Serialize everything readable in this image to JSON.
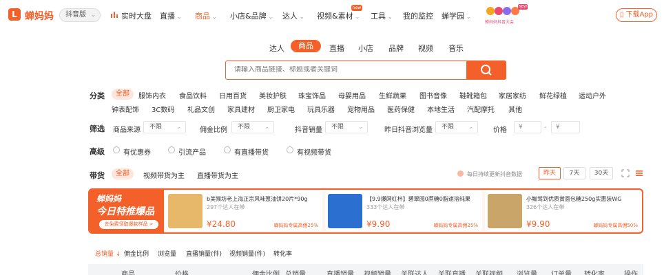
{
  "app": {
    "logo_mark": "L",
    "logo_text": "蝉妈妈",
    "version": "抖音版"
  },
  "nav": {
    "items": [
      {
        "label": "实时大盘"
      },
      {
        "label": "直播"
      },
      {
        "label": "商品"
      },
      {
        "label": "小店&品牌"
      },
      {
        "label": "达人"
      },
      {
        "label": "视频&素材"
      },
      {
        "label": "工具"
      },
      {
        "label": "我的监控"
      },
      {
        "label": "蝉学园"
      }
    ],
    "new_badge": "new",
    "promo_badge": "NEW",
    "promo_sub": "蝉妈妈抖音大会",
    "download": "下载App"
  },
  "search": {
    "tabs": [
      "达人",
      "商品",
      "直播",
      "小店",
      "品牌",
      "视频",
      "音乐"
    ],
    "active_tab": "商品",
    "placeholder": "请输入商品链接、标题或者关键词"
  },
  "filters": {
    "category_label": "分类",
    "categories_row1": [
      "全部",
      "服饰内衣",
      "食品饮料",
      "日用百货",
      "美妆护肤",
      "珠宝饰品",
      "母婴用品",
      "生鲜蔬果",
      "图书音像",
      "鞋靴箱包",
      "家居家纺",
      "鲜花绿植",
      "运动户外"
    ],
    "categories_row2": [
      "钟表配饰",
      "3C数码",
      "礼品文创",
      "家具建材",
      "厨卫家电",
      "玩具乐器",
      "宠物用品",
      "医药保健",
      "本地生活",
      "汽配摩托",
      "其他"
    ],
    "screen_label": "筛选",
    "screens": [
      {
        "label": "商品来源",
        "value": "不限"
      },
      {
        "label": "佣金比例",
        "value": "不限"
      },
      {
        "label": "抖音销量",
        "value": "不限"
      },
      {
        "label": "昨日抖音浏览量",
        "value": "不限"
      }
    ],
    "price_label": "价格",
    "price_min": "¥",
    "price_sep": "-",
    "price_max": "¥",
    "advanced_label": "高级",
    "advanced": [
      "有优惠券",
      "引流产品",
      "有直播带货",
      "有视频带货"
    ],
    "carry_label": "带货",
    "carry": [
      "全部",
      "视频带货为主",
      "直播带货为主"
    ],
    "update_note": "每日持续更新抖音数据",
    "date_ranges": [
      "昨天",
      "7天",
      "30天"
    ]
  },
  "banner": {
    "title1": "蝉妈妈",
    "title2": "今日特推爆品",
    "button": "去免费领取爆款样品 >",
    "products": [
      {
        "title": "b美猴坊老上海正宗风味葱油饼20片*90g",
        "sub": "297个达人在带",
        "price": "¥24.80",
        "tag": "蝉妈妈专属高佣25%"
      },
      {
        "title": "【9.9爆网红杯】碧翠园0蔗糖0脂速溶纯果",
        "sub": "333个达人在带",
        "price": "¥9.90",
        "tag": "蝉妈妈专属高佣25%"
      },
      {
        "title": "小鲅驾到优质黄面包糖250g实惠装WG",
        "sub": "326个达人在带",
        "price": "¥9.90",
        "tag": "蝉妈妈专属高佣50%"
      }
    ]
  },
  "sort": {
    "items": [
      "总销量",
      "佣金比例",
      "浏览量",
      "直播销量(件)",
      "视频销量(件)",
      "转化率"
    ],
    "active": "总销量"
  },
  "table": {
    "headers": [
      "商品",
      "价格",
      "佣金比例",
      "总销量",
      "直播销量",
      "视频销量",
      "关联达人",
      "关联直播",
      "关联视频",
      "浏览量",
      "订单量",
      "转化率",
      "操作"
    ]
  },
  "colors": {
    "accent": "#f4602a",
    "accent_light": "#fde6dd"
  }
}
